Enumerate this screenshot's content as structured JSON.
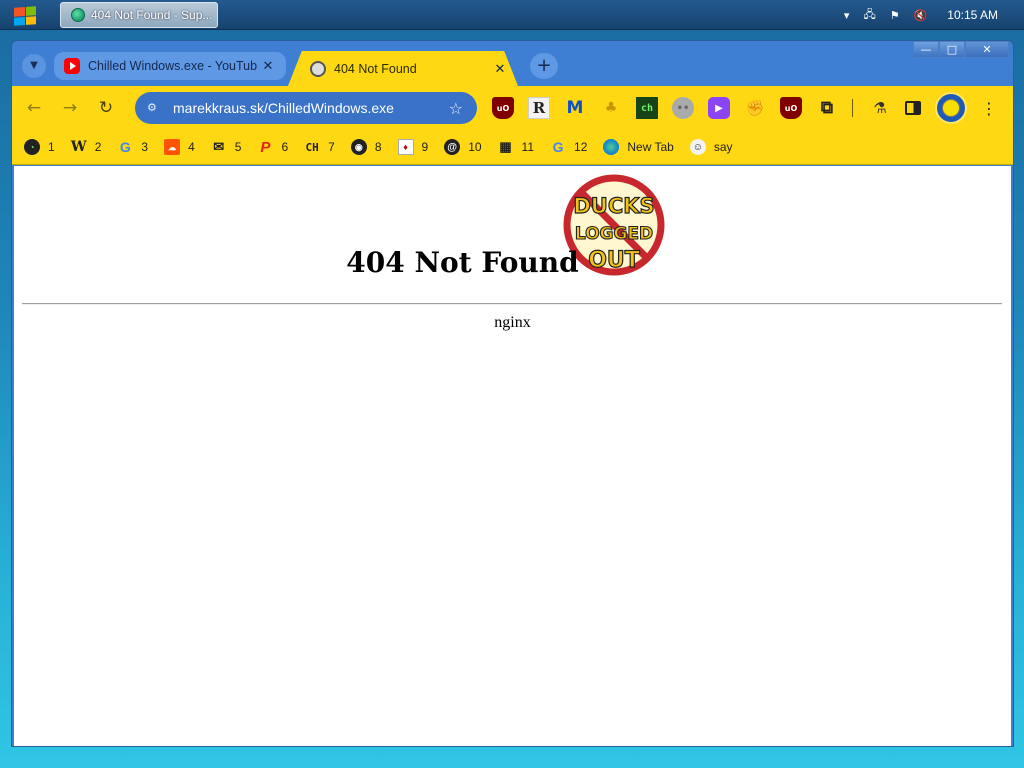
{
  "taskbar": {
    "task_title": "404 Not Found - Sup...",
    "clock": "10:15 AM"
  },
  "window": {
    "minimize": "—",
    "maximize": "□",
    "close": "✕"
  },
  "tabs": [
    {
      "title": "Chilled Windows.exe - YouTub",
      "close": "✕"
    },
    {
      "title": "404 Not Found",
      "close": "✕"
    }
  ],
  "toolbar": {
    "back": "←",
    "forward": "→",
    "reload": "↻",
    "url": "marekkraus.sk/ChilledWindows.exe",
    "star": "☆",
    "menu": "⋮"
  },
  "bookmarks": [
    {
      "label": "1",
      "icon": "speedometer-icon"
    },
    {
      "label": "2",
      "icon": "wikipedia-icon"
    },
    {
      "label": "3",
      "icon": "google-icon"
    },
    {
      "label": "4",
      "icon": "soundcloud-icon"
    },
    {
      "label": "5",
      "icon": "mail-icon"
    },
    {
      "label": "6",
      "icon": "p-icon"
    },
    {
      "label": "7",
      "icon": "ch-icon"
    },
    {
      "label": "8",
      "icon": "github-icon"
    },
    {
      "label": "9",
      "icon": "card-icon"
    },
    {
      "label": "10",
      "icon": "threads-icon"
    },
    {
      "label": "11",
      "icon": "building-icon"
    },
    {
      "label": "12",
      "icon": "google-icon"
    },
    {
      "label": "New Tab",
      "icon": "edge-icon"
    },
    {
      "label": "say",
      "icon": "face-icon"
    }
  ],
  "page": {
    "title": "404 Not Found",
    "server": "nginx",
    "logo_line1": "DUCKS",
    "logo_line2": "LOGGED",
    "logo_line3": "OUT"
  },
  "colors": {
    "chrome_yellow": "#ffd814",
    "frame_blue": "#3e7fd4",
    "omnibox_blue": "#3a72c8"
  }
}
